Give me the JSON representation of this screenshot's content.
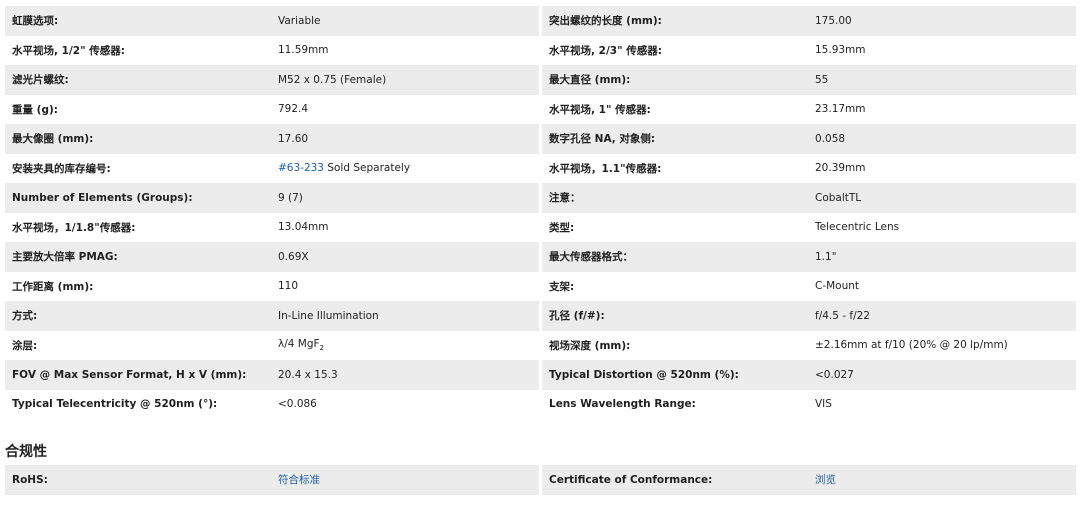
{
  "specs": {
    "left": [
      {
        "label": "虹膜选项:",
        "value": "Variable"
      },
      {
        "label": "水平视场, 1/2\" 传感器:",
        "value": "11.59mm"
      },
      {
        "label": "滤光片螺纹:",
        "value": "M52 x 0.75 (Female)"
      },
      {
        "label": "重量 (g):",
        "value": "792.4"
      },
      {
        "label": "最大像圈 (mm):",
        "value": "17.60"
      },
      {
        "label": "安装夹具的库存编号:",
        "value_link": "#63-233",
        "value_suffix": " Sold Separately"
      },
      {
        "label": "Number of Elements (Groups):",
        "value": "9 (7)"
      },
      {
        "label": "水平视场，1/1.8\"传感器:",
        "value": "13.04mm"
      },
      {
        "label": "主要放大倍率 PMAG:",
        "value": "0.69X"
      },
      {
        "label": "工作距离 (mm):",
        "value": "110"
      },
      {
        "label": "方式:",
        "value": "In-Line Illumination"
      },
      {
        "label": "涂层:",
        "value": "λ/4 MgF",
        "value_sub": "2"
      },
      {
        "label": "FOV @ Max Sensor Format, H x V (mm):",
        "value": "20.4 x 15.3"
      },
      {
        "label": "Typical Telecentricity @ 520nm (°):",
        "value": "<0.086"
      }
    ],
    "right": [
      {
        "label": "突出螺纹的长度 (mm):",
        "value": "175.00"
      },
      {
        "label": "水平视场, 2/3\" 传感器:",
        "value": "15.93mm"
      },
      {
        "label": "最大直径 (mm):",
        "value": "55"
      },
      {
        "label": "水平视场, 1\" 传感器:",
        "value": "23.17mm"
      },
      {
        "label": "数字孔径 NA, 对象侧:",
        "value": "0.058"
      },
      {
        "label": "水平视场，1.1\"传感器:",
        "value": "20.39mm"
      },
      {
        "label": "注意：",
        "value": "CobaltTL"
      },
      {
        "label": "类型:",
        "value": "Telecentric Lens"
      },
      {
        "label": "最大传感器格式：",
        "value": "1.1\""
      },
      {
        "label": "支架:",
        "value": "C-Mount"
      },
      {
        "label": "孔径 (f/#):",
        "value": "f/4.5 - f/22"
      },
      {
        "label": "视场深度 (mm):",
        "value": "±2.16mm at f/10 (20% @ 20 lp/mm)"
      },
      {
        "label": "Typical Distortion @ 520nm (%):",
        "value": "<0.027"
      },
      {
        "label": "Lens Wavelength Range:",
        "value": "VIS"
      }
    ]
  },
  "compliance": {
    "title": "合规性",
    "left": {
      "label": "RoHS:",
      "link": "符合标准"
    },
    "right": {
      "label": "Certificate of Conformance:",
      "link": "浏览"
    }
  }
}
